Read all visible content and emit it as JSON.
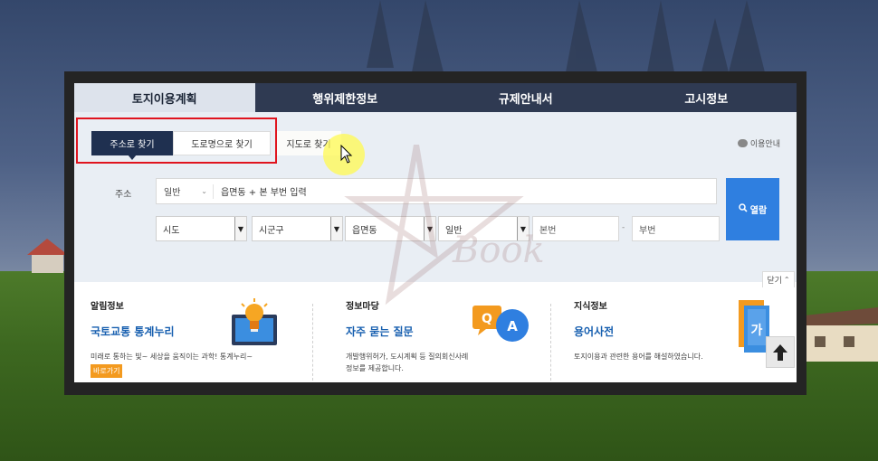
{
  "main_tabs": [
    {
      "label": "토지이용계획",
      "active": true
    },
    {
      "label": "행위제한정보",
      "active": false
    },
    {
      "label": "규제안내서",
      "active": false
    },
    {
      "label": "고시정보",
      "active": false
    }
  ],
  "sub_tabs": [
    {
      "label": "주소로 찾기",
      "active": true
    },
    {
      "label": "도로명으로 찾기",
      "active": false
    },
    {
      "label": "지도로 찾기",
      "active": false
    }
  ],
  "usage_guide": "이용안내",
  "address": {
    "label": "주소",
    "mode": "일반",
    "value": "읍면동 + 본 부번 입력"
  },
  "selects": {
    "sido": "시도",
    "sigungu": "시군구",
    "eupmyeondong": "읍면동",
    "type": "일반"
  },
  "inputs": {
    "bonbeon": "본번",
    "bubeon": "부번",
    "dash": "-"
  },
  "browse_button": "열람",
  "close_button": "닫기",
  "watermark_text": "Book",
  "panels": [
    {
      "title": "알림정보",
      "link": "국토교통 통계누리",
      "desc": "미래로 통하는 빛~ 세상을 움직이는 과학! 통계누리~",
      "badge": "바로가기"
    },
    {
      "title": "정보마당",
      "link": "자주 묻는 질문",
      "desc": "개발행위허가, 도시계획 등 질의회신사례 정보를 제공합니다."
    },
    {
      "title": "지식정보",
      "link": "용어사전",
      "desc": "토지이용과 관련한 용어를 해설하였습니다."
    }
  ],
  "colors": {
    "tab_dark": "#2f3a52",
    "tab_active": "#dde3ec",
    "subtab_active": "#1f3050",
    "accent_blue": "#2f7fe0",
    "link_blue": "#1860b0",
    "badge_orange": "#f39a1f",
    "highlight_red": "#e0141e"
  },
  "icons": [
    "monitor-bulb-icon",
    "qa-bubbles-icon",
    "books-icon",
    "arrow-up-icon",
    "search-icon",
    "chat-bubble-icon",
    "mouse-cursor-icon"
  ]
}
